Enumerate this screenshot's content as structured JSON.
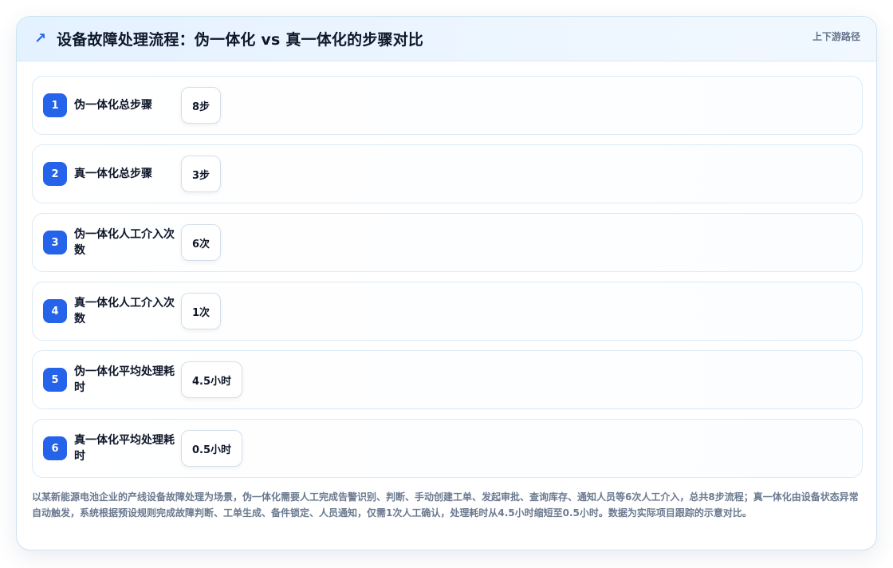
{
  "header": {
    "icon": "trend-arrow-icon",
    "title": "设备故障处理流程：伪一体化 vs 真一体化的步骤对比",
    "tag": "上下游路径"
  },
  "rows": [
    {
      "index": "1",
      "label": "伪一体化总步骤",
      "value": "8步"
    },
    {
      "index": "2",
      "label": "真一体化总步骤",
      "value": "3步"
    },
    {
      "index": "3",
      "label": "伪一体化人工介入次数",
      "value": "6次"
    },
    {
      "index": "4",
      "label": "真一体化人工介入次数",
      "value": "1次"
    },
    {
      "index": "5",
      "label": "伪一体化平均处理耗时",
      "value": "4.5小时"
    },
    {
      "index": "6",
      "label": "真一体化平均处理耗时",
      "value": "0.5小时"
    }
  ],
  "note": "以某新能源电池企业的产线设备故障处理为场景，伪一体化需要人工完成告警识别、判断、手动创建工单、发起审批、查询库存、通知人员等6次人工介入，总共8步流程；真一体化由设备状态异常自动触发，系统根据预设规则完成故障判断、工单生成、备件锁定、人员通知，仅需1次人工确认，处理耗时从4.5小时缩短至0.5小时。数据为实际项目跟踪的示意对比。",
  "colors": {
    "accent": "#2563eb",
    "text": "#0f172a",
    "muted": "#6b7a90"
  }
}
